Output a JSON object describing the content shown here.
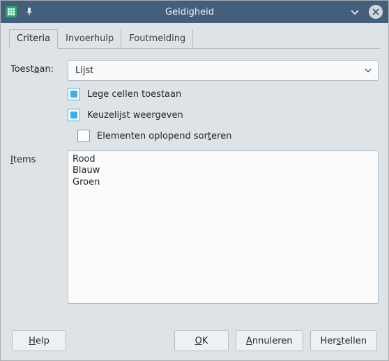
{
  "window": {
    "title": "Geldigheid"
  },
  "tabs": [
    {
      "label": "Criteria",
      "active": true
    },
    {
      "label": "Invoerhulp",
      "active": false
    },
    {
      "label": "Foutmelding",
      "active": false
    }
  ],
  "form": {
    "allow_label_pre": "Toest",
    "allow_label_accel": "a",
    "allow_label_post": "an:",
    "allow_value": "Lijst",
    "cb_empty": {
      "checked": true,
      "label": "Lege cellen toestaan"
    },
    "cb_list": {
      "checked": true,
      "label": "Keuzelijst weergeven"
    },
    "cb_sort": {
      "checked": false,
      "label_pre": "Elementen oplopend sor",
      "label_accel": "t",
      "label_post": "eren"
    },
    "items_label_accel": "I",
    "items_label_post": "tems",
    "items_value": "Rood\nBlauw\nGroen"
  },
  "buttons": {
    "help_accel": "H",
    "help_post": "elp",
    "ok_accel": "O",
    "ok_post": "K",
    "cancel_pre": "",
    "cancel_accel": "A",
    "cancel_post": "nnuleren",
    "reset_pre": "Her",
    "reset_accel": "s",
    "reset_post": "tellen"
  }
}
